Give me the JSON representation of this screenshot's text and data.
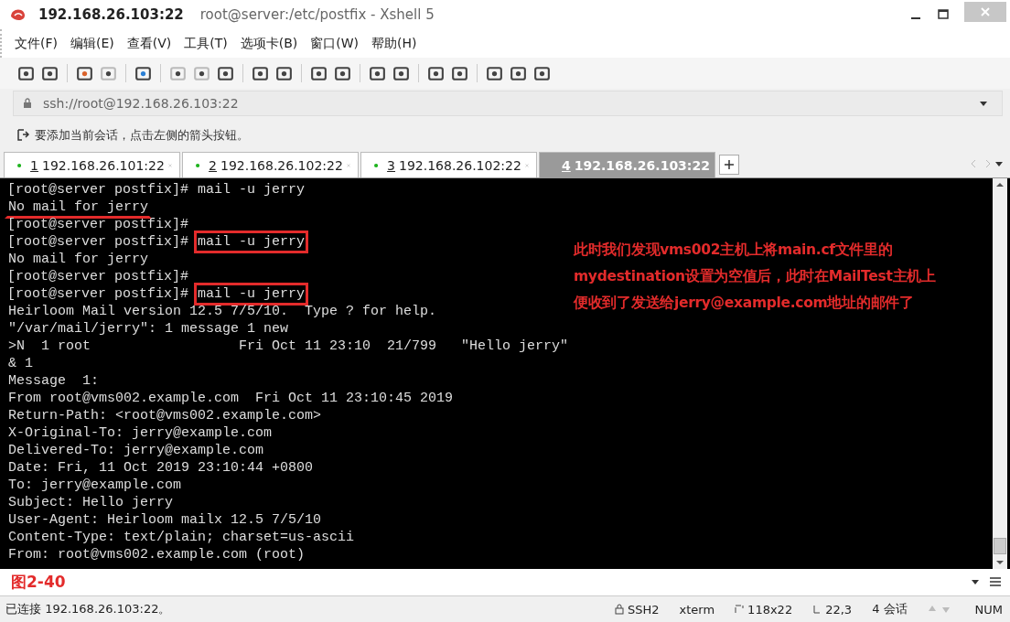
{
  "window": {
    "host": "192.168.26.103:22",
    "title": "root@server:/etc/postfix - Xshell 5"
  },
  "menu": [
    "文件(F)",
    "编辑(E)",
    "查看(V)",
    "工具(T)",
    "选项卡(B)",
    "窗口(W)",
    "帮助(H)"
  ],
  "address": {
    "value": "ssh://root@192.168.26.103:22"
  },
  "hint": "要添加当前会话，点击左侧的箭头按钮。",
  "tabs": [
    {
      "number": "1",
      "label": "192.168.26.101:22",
      "selected": false
    },
    {
      "number": "2",
      "label": "192.168.26.102:22",
      "selected": false
    },
    {
      "number": "3",
      "label": "192.168.26.102:22",
      "selected": false
    },
    {
      "number": "4",
      "label": "192.168.26.103:22",
      "selected": true
    }
  ],
  "terminal": {
    "lines": [
      {
        "prompt": "[root@server postfix]#",
        "text": "mail -u jerry",
        "boxed": false,
        "underlined": false
      },
      {
        "text": "No mail for jerry",
        "boxed": false,
        "underlined": true
      },
      {
        "prompt": "[root@server postfix]#"
      },
      {
        "prompt": "[root@server postfix]#",
        "text": "mail -u jerry",
        "boxed": true,
        "underlined": false
      },
      {
        "text": "No mail for jerry",
        "boxed": false,
        "underlined": false
      },
      {
        "prompt": "[root@server postfix]#"
      },
      {
        "prompt": "[root@server postfix]#",
        "text": "mail -u jerry",
        "boxed": true,
        "underlined": false
      },
      {
        "text": "Heirloom Mail version 12.5 7/5/10.  Type ? for help.",
        "boxed": false,
        "underlined": false
      },
      {
        "text": "\"/var/mail/jerry\": 1 message 1 new",
        "boxed": false,
        "underlined": false
      },
      {
        "text": ">N  1 root                  Fri Oct 11 23:10  21/799   \"Hello jerry\"",
        "boxed": false,
        "underlined": false
      },
      {
        "text": "& 1",
        "boxed": false,
        "underlined": false
      },
      {
        "text": "Message  1:",
        "boxed": false,
        "underlined": false
      },
      {
        "text": "From root@vms002.example.com  Fri Oct 11 23:10:45 2019",
        "boxed": false,
        "underlined": false
      },
      {
        "text": "Return-Path: <root@vms002.example.com>",
        "boxed": false,
        "underlined": false
      },
      {
        "text": "X-Original-To: jerry@example.com",
        "boxed": false,
        "underlined": false
      },
      {
        "text": "Delivered-To: jerry@example.com",
        "boxed": false,
        "underlined": false
      },
      {
        "text": "Date: Fri, 11 Oct 2019 23:10:44 +0800",
        "boxed": false,
        "underlined": false
      },
      {
        "text": "To: jerry@example.com",
        "boxed": false,
        "underlined": false
      },
      {
        "text": "Subject: Hello jerry",
        "boxed": false,
        "underlined": false
      },
      {
        "text": "User-Agent: Heirloom mailx 12.5 7/5/10",
        "boxed": false,
        "underlined": false
      },
      {
        "text": "Content-Type: text/plain; charset=us-ascii",
        "boxed": false,
        "underlined": false
      },
      {
        "text": "From: root@vms002.example.com (root)",
        "boxed": false,
        "underlined": false
      }
    ],
    "note": [
      "此时我们发现vms002主机上将main.cf文件里的",
      "mydestination设置为空值后，此时在MailTest主机上",
      "便收到了发送给jerry@example.com地址的邮件了"
    ]
  },
  "caption": "图2-40",
  "status": {
    "connection": "已连接 192.168.26.103:22。",
    "protocol": "SSH2",
    "term": "xterm",
    "size": "118x22",
    "cursor": "22,3",
    "sessions": "4 会话",
    "num": "NUM"
  }
}
